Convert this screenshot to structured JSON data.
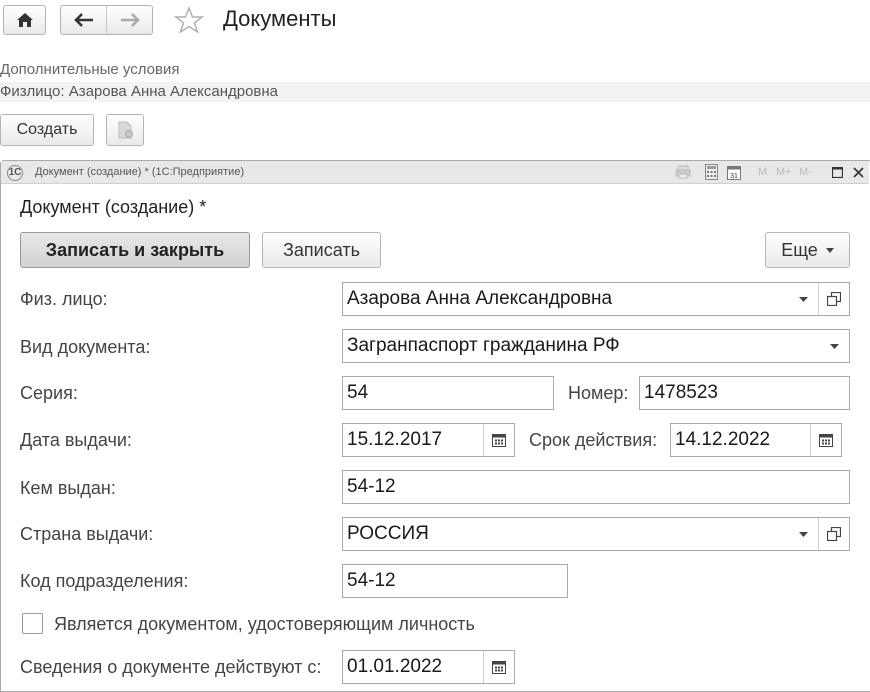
{
  "page": {
    "title": "Документы",
    "extra_conditions": "Дополнительные условия",
    "filter_person": "Физлицо: Азарова Анна Александровна",
    "create_label": "Создать"
  },
  "window": {
    "caption": "Документ (создание) * (1С:Предприятие)",
    "caption_buttons": [
      "M",
      "M+",
      "M-"
    ],
    "form_title": "Документ (создание) *",
    "save_close_label": "Записать и закрыть",
    "save_label": "Записать",
    "more_label": "Еще"
  },
  "form": {
    "person": {
      "label": "Физ. лицо:",
      "value": "Азарова Анна Александровна"
    },
    "doc_type": {
      "label": "Вид документа:",
      "value": "Загранпаспорт гражданина РФ"
    },
    "series": {
      "label": "Серия:",
      "value": "54"
    },
    "number": {
      "label": "Номер:",
      "value": "1478523"
    },
    "issue_date": {
      "label": "Дата выдачи:",
      "value": "15.12.2017"
    },
    "valid_until": {
      "label": "Срок действия:",
      "value": "14.12.2022"
    },
    "issued_by": {
      "label": "Кем выдан:",
      "value": "54-12"
    },
    "country": {
      "label": "Страна выдачи:",
      "value": "РОССИЯ"
    },
    "dept_code": {
      "label": "Код подразделения:",
      "value": "54-12"
    },
    "is_identity": {
      "label": "Является документом, удостоверяющим личность",
      "checked": false
    },
    "valid_from": {
      "label": "Сведения о документе действуют с:",
      "value": "01.01.2022"
    }
  },
  "colors": {
    "window_header": "#e8e8e8",
    "border": "#a9a9a9",
    "label": "#444444"
  },
  "icons": [
    "home-icon",
    "back-arrow-icon",
    "forward-arrow-icon",
    "star-icon",
    "copy-document-icon",
    "1c-logo-icon",
    "print-icon",
    "calculator-icon",
    "calendar-icon",
    "restore-icon",
    "close-icon",
    "dropdown-arrow-icon",
    "open-icon"
  ]
}
